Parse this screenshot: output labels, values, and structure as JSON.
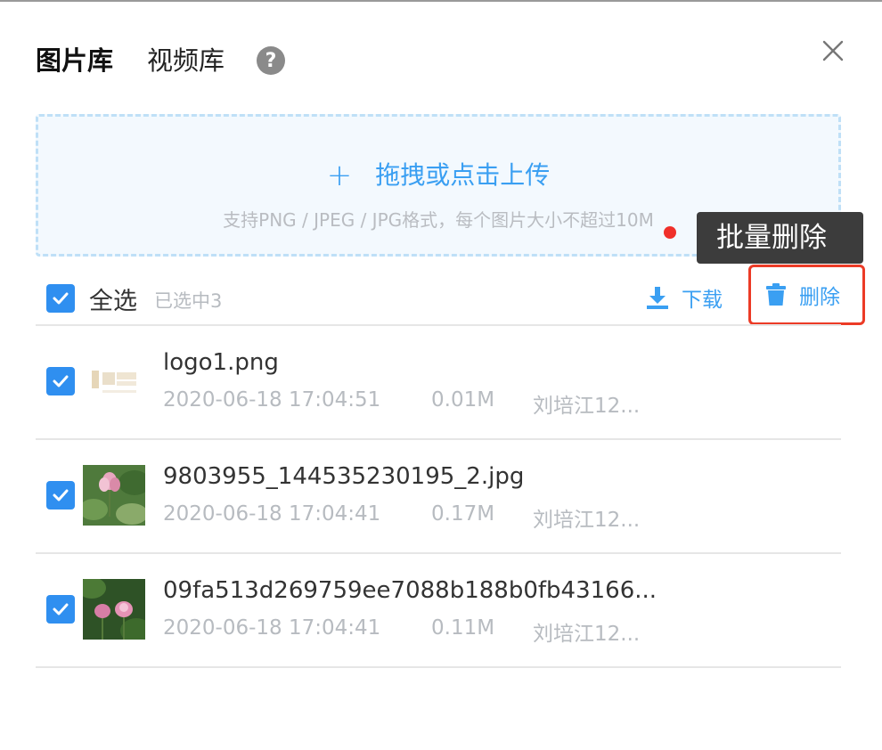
{
  "tabs": [
    {
      "label": "图片库",
      "active": true
    },
    {
      "label": "视频库",
      "active": false
    }
  ],
  "help_icon": "?",
  "upload": {
    "title": "拖拽或点击上传",
    "plus": "+",
    "hint": "支持PNG / JPEG / JPG格式，每个图片大小不超过10M"
  },
  "tooltip": "批量删除",
  "toolbar": {
    "select_all": "全选",
    "selected_count": "已选中3",
    "download": "下载",
    "delete": "删除"
  },
  "files": [
    {
      "name": "logo1.png",
      "date": "2020-06-18 17:04:51",
      "size": "0.01M",
      "owner": "刘培江12...",
      "checked": true,
      "thumb": "logo"
    },
    {
      "name": "9803955_144535230195_2.jpg",
      "date": "2020-06-18 17:04:41",
      "size": "0.17M",
      "owner": "刘培江12...",
      "checked": true,
      "thumb": "lotus-1"
    },
    {
      "name": "09fa513d269759ee7088b188b0fb43166...",
      "date": "2020-06-18 17:04:41",
      "size": "0.11M",
      "owner": "刘培江12...",
      "checked": true,
      "thumb": "lotus-2"
    }
  ],
  "colors": {
    "accent": "#3a9ff2",
    "checkbox": "#2f8ff0",
    "highlight_border": "#ec3b26",
    "tooltip_bg": "#3c3c3c"
  }
}
